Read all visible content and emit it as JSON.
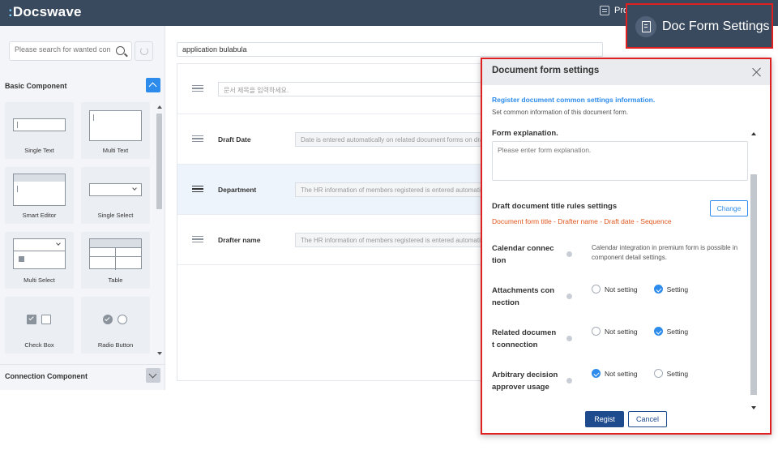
{
  "topbar": {
    "logo": "Docswave",
    "menu_label": "Pro"
  },
  "callout": {
    "label": "Doc Form Settings"
  },
  "sidebar": {
    "search_placeholder": "Please search for wanted comp",
    "basic_section": "Basic Component",
    "connection_section": "Connection Component",
    "components": [
      {
        "label": "Single Text"
      },
      {
        "label": "Multi Text"
      },
      {
        "label": "Smart Editor"
      },
      {
        "label": "Single Select"
      },
      {
        "label": "Multi Select"
      },
      {
        "label": "Table"
      },
      {
        "label": "Check Box"
      },
      {
        "label": "Radio Button"
      }
    ]
  },
  "form": {
    "app_title": "application bulabula",
    "title_placeholder": "문서 제목을 입력하세요.",
    "rows": [
      {
        "name": "Draft Date",
        "hint": "Date is entered automatically on related document forms on drafting."
      },
      {
        "name": "Department",
        "hint": "The HR information of members registered is entered automatically."
      },
      {
        "name": "Drafter name",
        "hint": "The HR information of members registered is entered automatically."
      }
    ]
  },
  "dialog": {
    "title": "Document form settings",
    "subtitle": "Register document common settings information.",
    "description": "Set common information of this document form.",
    "explanation_label": "Form explanation.",
    "explanation_placeholder": "Please enter form explanation.",
    "title_rules_label": "Draft document title rules settings",
    "change_label": "Change",
    "title_rule_value": "Document form title - Drafter name - Draft date - Sequence",
    "calendar_label_1": "Calendar connec",
    "calendar_label_2": "tion",
    "calendar_note": "Calendar integration in premium form is possible in component detail settings.",
    "attach_label_1": "Attachments con",
    "attach_label_2": "nection",
    "related_label_1": "Related documen",
    "related_label_2": "t connection",
    "arbitrary_label_1": "Arbitrary decision",
    "arbitrary_label_2": "approver usage",
    "opt_not_setting": "Not setting",
    "opt_setting": "Setting",
    "regist_label": "Regist",
    "cancel_label": "Cancel"
  },
  "colors": {
    "topbar": "#3a4a5e",
    "accent": "#2d8ceb",
    "primary_button": "#1e4b8e",
    "rule_text": "#e0541a",
    "highlight_border": "#e02020"
  }
}
